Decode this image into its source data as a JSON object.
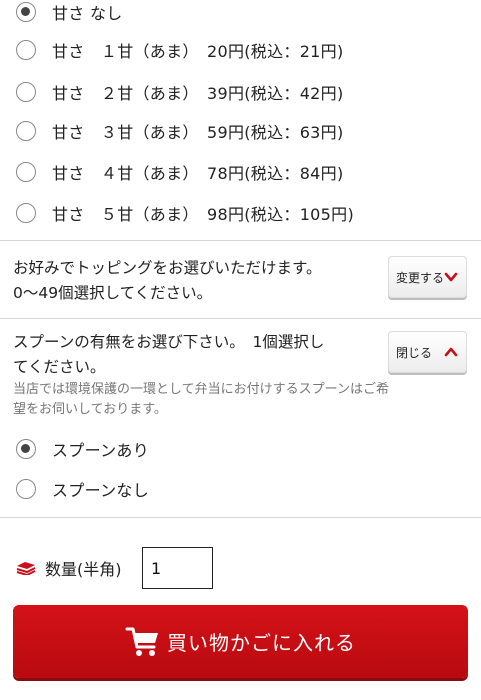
{
  "sweetness": {
    "options": [
      {
        "label": "甘さ なし",
        "checked": true
      },
      {
        "label": "甘さ　１甘（あま）　20円(税込：21円)",
        "checked": false
      },
      {
        "label": "甘さ　２甘（あま）　39円(税込：42円)",
        "checked": false
      },
      {
        "label": "甘さ　３甘（あま）　59円(税込：63円)",
        "checked": false
      },
      {
        "label": "甘さ　４甘（あま）　78円(税込：84円)",
        "checked": false
      },
      {
        "label": "甘さ　５甘（あま）　98円(税込：105円)",
        "checked": false
      }
    ]
  },
  "topping": {
    "line1": "お好みでトッピングをお選びいただけます。",
    "line2": "0〜49個選択してください。",
    "button_label": "変更する",
    "button_icon": "chevron-down-icon"
  },
  "spoon": {
    "line1": "スプーンの有無をお選び下さい。　1個選択し",
    "line2": "てください。",
    "note_line1": "当店では環境保護の一環として弁当にお付けするスプーンはご希",
    "note_line2": "望をお伺いしております。",
    "button_label": "閉じる",
    "button_icon": "chevron-up-icon",
    "options": [
      {
        "label": "スプーンあり",
        "checked": true
      },
      {
        "label": "スプーンなし",
        "checked": false
      }
    ]
  },
  "quantity": {
    "label": "数量(半角)",
    "value": "1",
    "icon": "stack-icon"
  },
  "cart": {
    "label": "買い物かごに入れる",
    "icon": "cart-icon"
  },
  "colors": {
    "accent": "#c8101a",
    "text": "#222222",
    "note": "#777777"
  }
}
